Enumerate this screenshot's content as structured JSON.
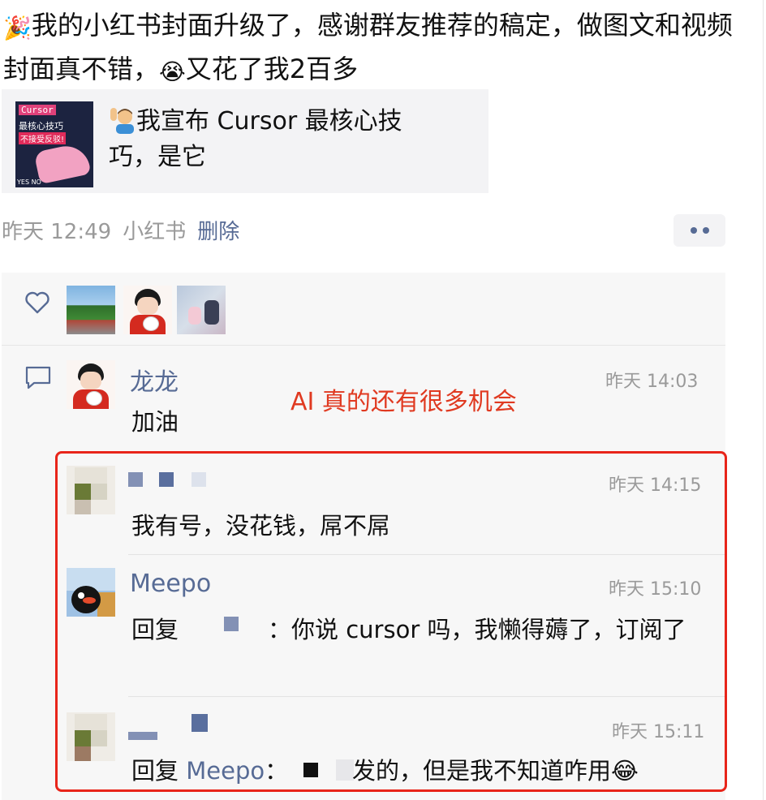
{
  "post": {
    "emoji": "🎉",
    "text": "我的小红书封面升级了，感谢群友推荐的稿定，做图文和视频封面真不错，",
    "cry_emoji": "😭",
    "text_tail": "又花了我2百多"
  },
  "link_card": {
    "thumb_line1": "Cursor",
    "thumb_line2": "最核心技巧",
    "thumb_line3": "不接受反驳!",
    "thumb_footer": "YES NO",
    "emoji": "🙋‍♂️",
    "title": "我宣布 Cursor 最核心技巧，是它"
  },
  "meta": {
    "time": "昨天 12:49",
    "source": "小红书",
    "delete_label": "删除"
  },
  "likes": {
    "avatars": [
      "road-avatar",
      "boy-avatar",
      "couple-avatar"
    ]
  },
  "annotation": "AI 真的还有很多机会",
  "comments": [
    {
      "name": "龙龙",
      "time": "昨天 14:03",
      "text": "加油"
    },
    {
      "name": "",
      "time": "昨天 14:15",
      "text": "我有号，没花钱，屌不屌"
    },
    {
      "name": "Meepo",
      "time": "昨天 15:10",
      "reply_prefix": "回复",
      "text": "：你说 cursor 吗，我懒得薅了，订阅了"
    },
    {
      "name": "",
      "time": "昨天 15:11",
      "reply_prefix": "回复",
      "reply_to": "Meepo",
      "text_colon": "：",
      "text": "发的，但是我不知道咋用",
      "emoji": "😂"
    }
  ],
  "colors": {
    "link": "#576b95",
    "annotation": "#e03a21",
    "highlight_border": "#e8251a",
    "panel_bg": "#f7f7f7"
  }
}
